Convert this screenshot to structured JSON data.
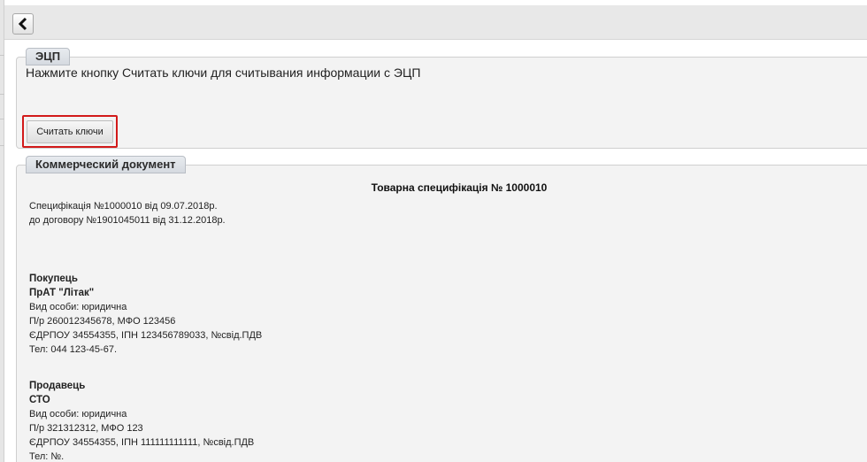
{
  "toolbar": {
    "back_icon": "chevron-left-icon"
  },
  "ecp_panel": {
    "title": "ЭЦП",
    "instruction": "Нажмите кнопку Считать ключи для считывания информации с ЭЦП",
    "read_keys_label": "Считать ключи"
  },
  "doc_panel": {
    "title": "Коммерческий документ",
    "doc_title": "Товарна специфікація № 1000010",
    "spec_line": "Специфікація №1000010 від 09.07.2018р.",
    "contract_line": "до договору №1901045011 від 31.12.2018р.",
    "buyer": {
      "heading": "Покупець",
      "name": "ПрАТ \"Літак\"",
      "type": "Вид особи: юридична",
      "account": "П/р 260012345678, МФО 123456",
      "codes": "ЄДРПОУ 34554355, ІПН 123456789033, №свід.ПДВ",
      "phone": "Тел: 044 123-45-67."
    },
    "seller": {
      "heading": "Продавець",
      "name": "СТО",
      "type": "Вид особи: юридична",
      "account": "П/р 321312312, МФО 123",
      "codes": "ЄДРПОУ 34554355, ІПН 111111111111, №свід.ПДВ",
      "phone": "Тел: №."
    }
  },
  "colors": {
    "highlight": "#d21a1a",
    "panel_bg": "#f3f3f3",
    "toolbar_bg": "#e8e8e8"
  }
}
